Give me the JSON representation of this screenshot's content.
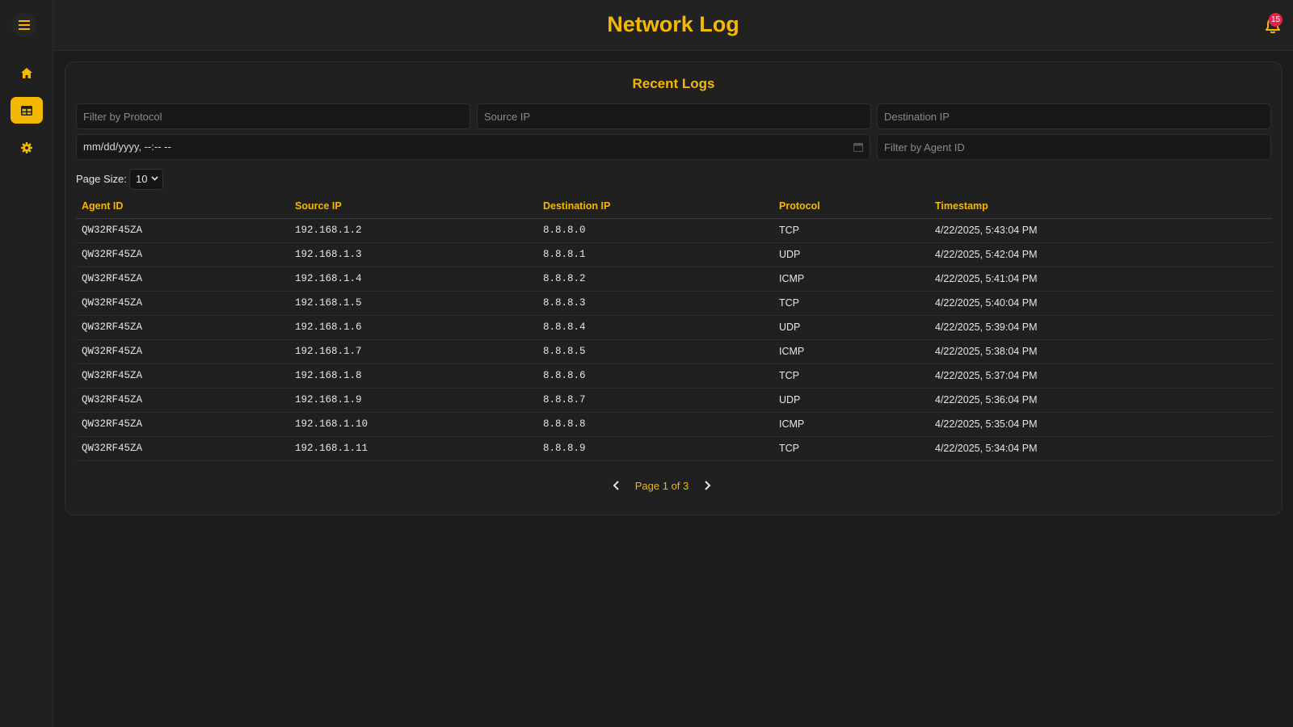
{
  "app": {
    "title": "Network Log",
    "notification_count": "15",
    "accent_color": "#f5b800",
    "badge_color": "#e0244a"
  },
  "sidebar": {
    "items": [
      {
        "icon": "menu-icon"
      },
      {
        "icon": "home-icon"
      },
      {
        "icon": "table-icon",
        "active": true
      },
      {
        "icon": "gear-icon"
      }
    ]
  },
  "card": {
    "title": "Recent Logs"
  },
  "filters": {
    "protocol_placeholder": "Filter by Protocol",
    "source_ip_placeholder": "Source IP",
    "destination_ip_placeholder": "Destination IP",
    "datetime_placeholder": "mm/dd/yyyy, --:-- --",
    "agent_id_placeholder": "Filter by Agent ID"
  },
  "page_size": {
    "label": "Page Size:",
    "value": "10"
  },
  "table": {
    "headers": [
      "Agent ID",
      "Source IP",
      "Destination IP",
      "Protocol",
      "Timestamp"
    ],
    "rows": [
      [
        "QW32RF45ZA",
        "192.168.1.2",
        "8.8.8.0",
        "TCP",
        "4/22/2025, 5:43:04 PM"
      ],
      [
        "QW32RF45ZA",
        "192.168.1.3",
        "8.8.8.1",
        "UDP",
        "4/22/2025, 5:42:04 PM"
      ],
      [
        "QW32RF45ZA",
        "192.168.1.4",
        "8.8.8.2",
        "ICMP",
        "4/22/2025, 5:41:04 PM"
      ],
      [
        "QW32RF45ZA",
        "192.168.1.5",
        "8.8.8.3",
        "TCP",
        "4/22/2025, 5:40:04 PM"
      ],
      [
        "QW32RF45ZA",
        "192.168.1.6",
        "8.8.8.4",
        "UDP",
        "4/22/2025, 5:39:04 PM"
      ],
      [
        "QW32RF45ZA",
        "192.168.1.7",
        "8.8.8.5",
        "ICMP",
        "4/22/2025, 5:38:04 PM"
      ],
      [
        "QW32RF45ZA",
        "192.168.1.8",
        "8.8.8.6",
        "TCP",
        "4/22/2025, 5:37:04 PM"
      ],
      [
        "QW32RF45ZA",
        "192.168.1.9",
        "8.8.8.7",
        "UDP",
        "4/22/2025, 5:36:04 PM"
      ],
      [
        "QW32RF45ZA",
        "192.168.1.10",
        "8.8.8.8",
        "ICMP",
        "4/22/2025, 5:35:04 PM"
      ],
      [
        "QW32RF45ZA",
        "192.168.1.11",
        "8.8.8.9",
        "TCP",
        "4/22/2025, 5:34:04 PM"
      ]
    ]
  },
  "pagination": {
    "text": "Page 1 of 3"
  }
}
